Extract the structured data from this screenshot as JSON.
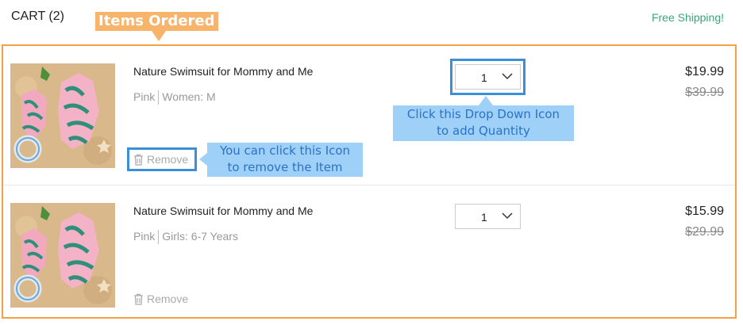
{
  "header": {
    "cart_title": "CART (2)",
    "free_shipping": "Free Shipping!"
  },
  "annotations": {
    "items_ordered": "Items Ordered",
    "dropdown_hint_line1": "Click this Drop Down Icon",
    "dropdown_hint_line2": "to add Quantity",
    "remove_hint_line1": "You can click this Icon",
    "remove_hint_line2": "to remove the Item"
  },
  "items": [
    {
      "name": "Nature Swimsuit for Mommy and Me",
      "color": "Pink",
      "size": "Women: M",
      "quantity": "1",
      "price": "$19.99",
      "original_price": "$39.99",
      "remove_label": "Remove"
    },
    {
      "name": "Nature Swimsuit for Mommy and Me",
      "color": "Pink",
      "size": "Girls: 6-7 Years",
      "quantity": "1",
      "price": "$15.99",
      "original_price": "$29.99",
      "remove_label": "Remove"
    }
  ],
  "colors": {
    "accent_orange": "#f5a043",
    "highlight_blue": "#3a8fd8",
    "callout_bg": "#9fd0f7",
    "free_shipping_green": "#3aa57a"
  },
  "icons": {
    "remove": "trash-icon",
    "dropdown": "chevron-down-icon"
  }
}
